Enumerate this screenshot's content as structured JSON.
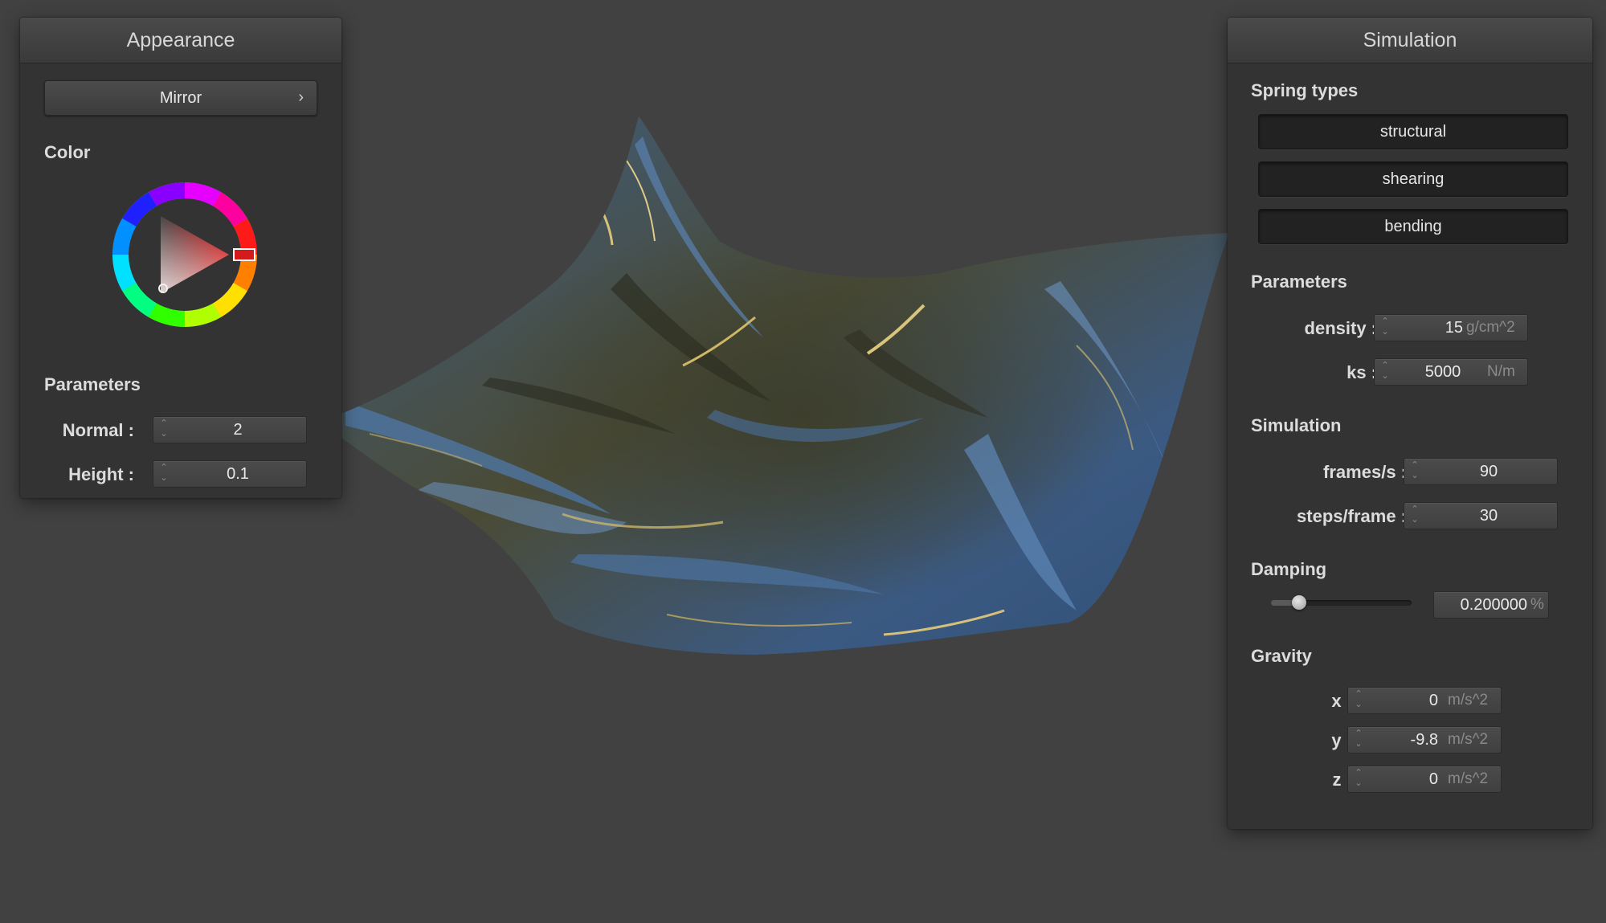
{
  "appearance": {
    "title": "Appearance",
    "material_label": "Mirror",
    "material_chevron": "›",
    "color_label": "Color",
    "selected_color": "#d41a1a",
    "parameters_label": "Parameters",
    "normal": {
      "label": "Normal :",
      "value": "2"
    },
    "height": {
      "label": "Height :",
      "value": "0.1"
    }
  },
  "simulation": {
    "title": "Simulation",
    "spring_types_label": "Spring types",
    "spring_types": [
      "structural",
      "shearing",
      "bending"
    ],
    "parameters_label": "Parameters",
    "density": {
      "label": "density :",
      "value": "15",
      "unit": "g/cm^2"
    },
    "ks": {
      "label": "ks :",
      "value": "5000",
      "unit": "N/m"
    },
    "simulation_label": "Simulation",
    "frames_per_second": {
      "label": "frames/s :",
      "value": "90"
    },
    "steps_per_frame": {
      "label": "steps/frame :",
      "value": "30"
    },
    "damping_label": "Damping",
    "damping": {
      "value": "0.200000",
      "unit": "%",
      "slider_fraction": 0.2
    },
    "gravity_label": "Gravity",
    "gravity": [
      {
        "label": "x :",
        "value": "0",
        "unit": "m/s^2"
      },
      {
        "label": "y :",
        "value": "-9.8",
        "unit": "m/s^2"
      },
      {
        "label": "z :",
        "value": "0",
        "unit": "m/s^2"
      }
    ]
  },
  "colors": {
    "background": "#414141",
    "panel": "#333333",
    "cloth_blue": "#3d5d85",
    "cloth_olive": "#5a5436",
    "cloth_gold": "#c9b66a"
  }
}
